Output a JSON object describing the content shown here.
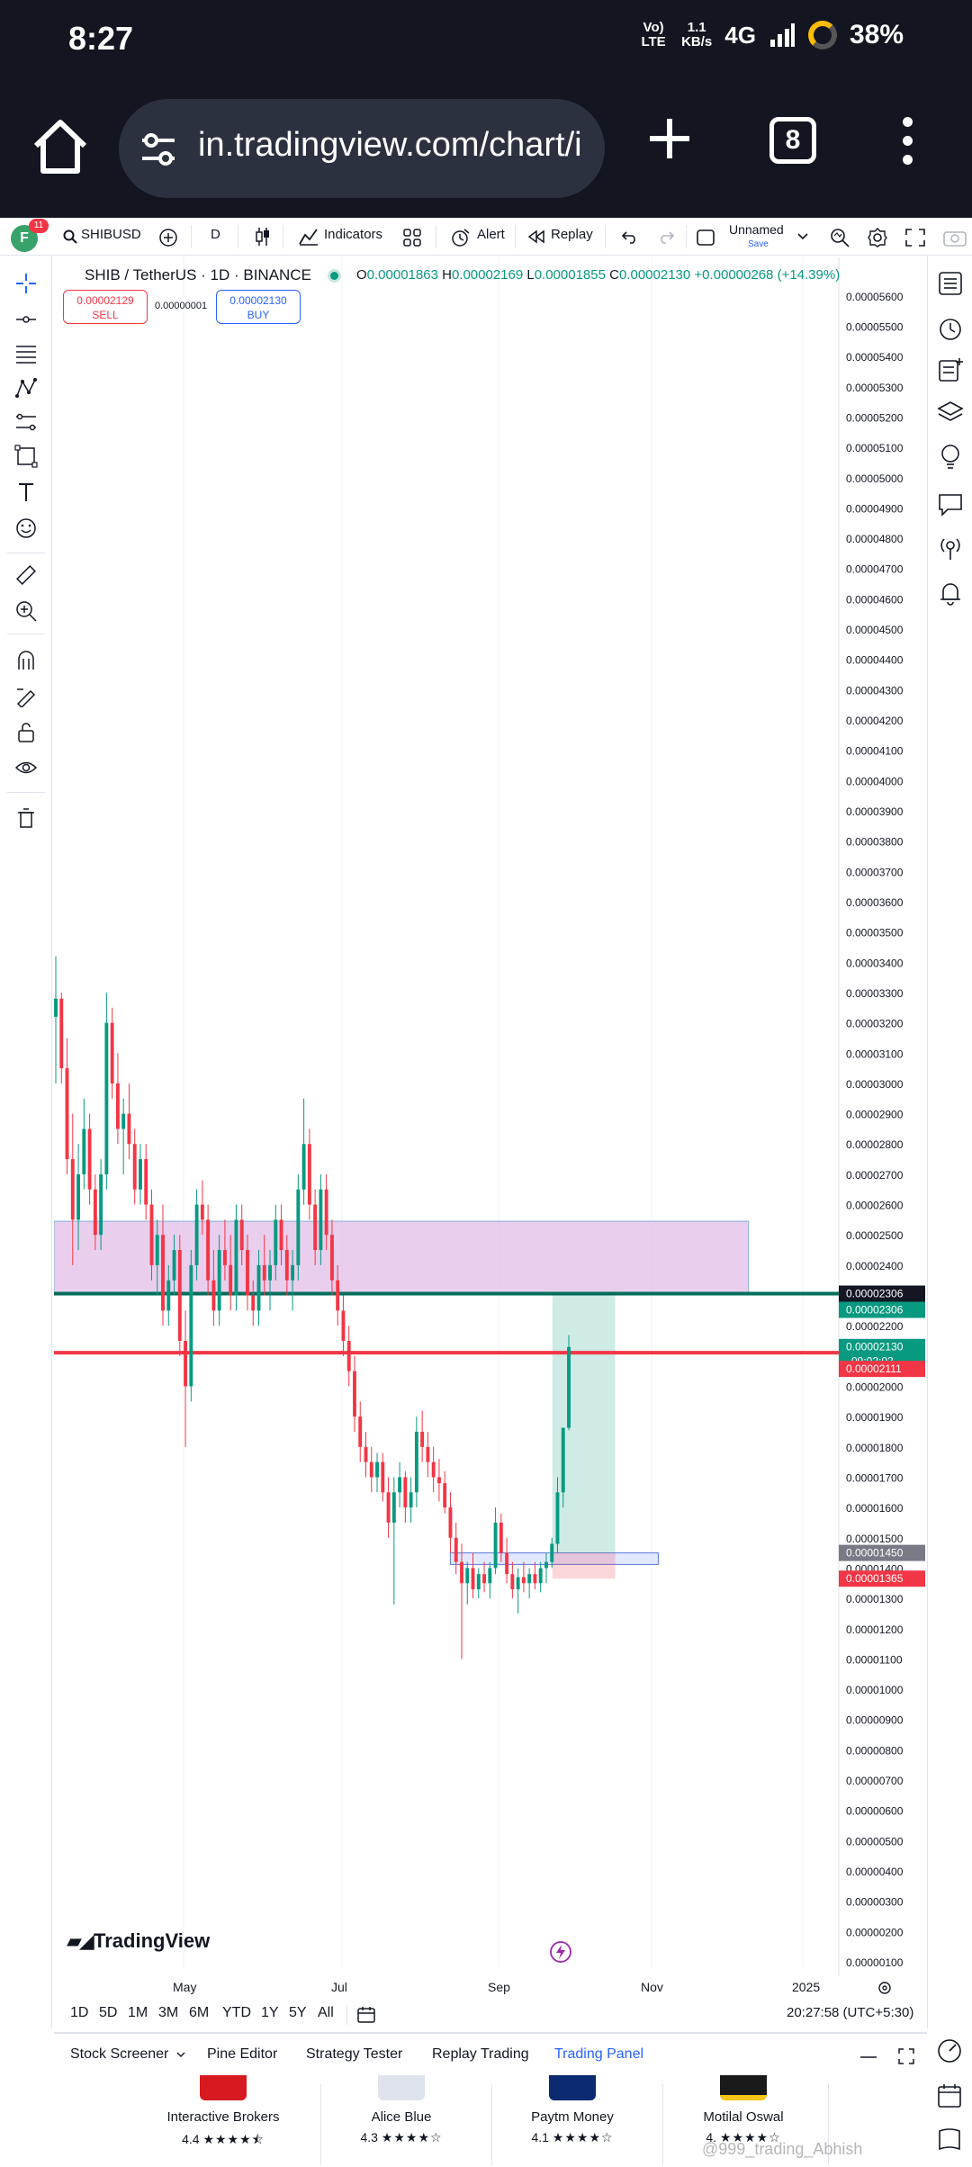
{
  "status": {
    "time": "8:27",
    "volte": "Vo) LTE",
    "speed_value": "1.1",
    "speed_unit": "KB/s",
    "network": "4G",
    "battery": "38%"
  },
  "browser": {
    "url": "in.tradingview.com/chart/i",
    "tab_count": "8"
  },
  "toolbar": {
    "avatar_letter": "F",
    "notifications": "11",
    "symbol": "SHIBUSD",
    "interval": "D",
    "indicators_label": "Indicators",
    "alert_label": "Alert",
    "replay_label": "Replay",
    "layout_name": "Unnamed",
    "save_label": "Save"
  },
  "legend": {
    "title": "SHIB / TetherUS · 1D · BINANCE",
    "open_label": "O",
    "open": "0.00001863",
    "high_label": "H",
    "high": "0.00002169",
    "low_label": "L",
    "low": "0.00001855",
    "close_label": "C",
    "close": "0.00002130",
    "change": "+0.00000268 (+14.39%)",
    "sell_price": "0.00002129",
    "sell_label": "SELL",
    "spread": "0.00000001",
    "buy_price": "0.00002130",
    "buy_label": "BUY"
  },
  "chart_data": {
    "type": "candlestick",
    "symbol": "SHIB / TetherUS",
    "interval": "1D",
    "exchange": "BINANCE",
    "y_ticks": [
      "0.00005600",
      "0.00005500",
      "0.00005400",
      "0.00005300",
      "0.00005200",
      "0.00005100",
      "0.00005000",
      "0.00004900",
      "0.00004800",
      "0.00004700",
      "0.00004600",
      "0.00004500",
      "0.00004400",
      "0.00004300",
      "0.00004200",
      "0.00004100",
      "0.00004000",
      "0.00003900",
      "0.00003800",
      "0.00003700",
      "0.00003600",
      "0.00003500",
      "0.00003400",
      "0.00003300",
      "0.00003200",
      "0.00003100",
      "0.00003000",
      "0.00002900",
      "0.00002800",
      "0.00002700",
      "0.00002600",
      "0.00002500",
      "0.00002400",
      "0.00002300",
      "0.00002200",
      "0.00002100",
      "0.00002000",
      "0.00001900",
      "0.00001800",
      "0.00001700",
      "0.00001600",
      "0.00001500",
      "0.00001400",
      "0.00001300",
      "0.00001200",
      "0.00001100",
      "0.00001000",
      "0.00000900",
      "0.00000800",
      "0.00000700",
      "0.00000600",
      "0.00000500",
      "0.00000400",
      "0.00000300",
      "0.00000200",
      "0.00000100"
    ],
    "x_ticks": [
      "May",
      "Jul",
      "Sep",
      "Nov",
      "2025"
    ],
    "ylim": [
      1e-06,
      5.65e-05
    ],
    "price_labels": [
      {
        "value": 2.306e-05,
        "text": "0.00002306",
        "color": "#131722"
      },
      {
        "value": 2.306e-05,
        "text": "0.00002306",
        "color": "#089981"
      },
      {
        "value": 2.13e-05,
        "text": "0.00002130",
        "sub": "09:02:02",
        "color": "#089981"
      },
      {
        "value": 2.111e-05,
        "text": "0.00002111",
        "color": "#f23645"
      },
      {
        "value": 1.45e-05,
        "text": "0.00001450",
        "color": "#787b86"
      },
      {
        "value": 1.365e-05,
        "text": "0.00001365",
        "color": "#f23645"
      }
    ],
    "horizontal_lines": [
      {
        "value": 2.306e-05,
        "color": "#006d5b"
      },
      {
        "value": 2.111e-05,
        "color": "#f23645"
      }
    ],
    "zones": [
      {
        "from": 2.306e-05,
        "to": 2.545e-05,
        "color": "#e1bee7",
        "t_from": 0.0,
        "t_to": 0.885
      },
      {
        "from": 1.412e-05,
        "to": 1.45e-05,
        "color": "#cfd8ff",
        "t_from": 0.505,
        "t_to": 0.77
      }
    ],
    "position": {
      "entry": 1.45e-05,
      "target": 2.306e-05,
      "stop": 1.365e-05,
      "t_from": 0.635,
      "t_to": 0.715
    },
    "candles": [
      [
        3.22e-05,
        3.42e-05,
        3e-05,
        3.28e-05
      ],
      [
        3.28e-05,
        3.3e-05,
        3e-05,
        3.05e-05
      ],
      [
        3.05e-05,
        3.15e-05,
        2.7e-05,
        2.75e-05
      ],
      [
        2.75e-05,
        2.9e-05,
        2.4e-05,
        2.55e-05
      ],
      [
        2.55e-05,
        2.8e-05,
        2.45e-05,
        2.7e-05
      ],
      [
        2.7e-05,
        2.95e-05,
        2.65e-05,
        2.85e-05
      ],
      [
        2.85e-05,
        2.9e-05,
        2.6e-05,
        2.65e-05
      ],
      [
        2.65e-05,
        2.7e-05,
        2.45e-05,
        2.5e-05
      ],
      [
        2.5e-05,
        2.75e-05,
        2.45e-05,
        2.7e-05
      ],
      [
        2.7e-05,
        3.3e-05,
        2.65e-05,
        3.2e-05
      ],
      [
        3.2e-05,
        3.25e-05,
        2.95e-05,
        3e-05
      ],
      [
        3e-05,
        3.1e-05,
        2.8e-05,
        2.85e-05
      ],
      [
        2.85e-05,
        2.95e-05,
        2.7e-05,
        2.9e-05
      ],
      [
        2.9e-05,
        3e-05,
        2.75e-05,
        2.8e-05
      ],
      [
        2.8e-05,
        2.85e-05,
        2.6e-05,
        2.65e-05
      ],
      [
        2.65e-05,
        2.8e-05,
        2.6e-05,
        2.75e-05
      ],
      [
        2.75e-05,
        2.8e-05,
        2.55e-05,
        2.6e-05
      ],
      [
        2.6e-05,
        2.65e-05,
        2.35e-05,
        2.4e-05
      ],
      [
        2.4e-05,
        2.55e-05,
        2.3e-05,
        2.5e-05
      ],
      [
        2.5e-05,
        2.6e-05,
        2.2e-05,
        2.25e-05
      ],
      [
        2.25e-05,
        2.4e-05,
        2.2e-05,
        2.35e-05
      ],
      [
        2.35e-05,
        2.5e-05,
        2.3e-05,
        2.45e-05
      ],
      [
        2.45e-05,
        2.5e-05,
        2.1e-05,
        2.15e-05
      ],
      [
        2.15e-05,
        2.25e-05,
        1.8e-05,
        2e-05
      ],
      [
        2e-05,
        2.45e-05,
        1.95e-05,
        2.4e-05
      ],
      [
        2.4e-05,
        2.65e-05,
        2.35e-05,
        2.6e-05
      ],
      [
        2.6e-05,
        2.68e-05,
        2.5e-05,
        2.55e-05
      ],
      [
        2.55e-05,
        2.6e-05,
        2.3e-05,
        2.35e-05
      ],
      [
        2.35e-05,
        2.45e-05,
        2.2e-05,
        2.25e-05
      ],
      [
        2.25e-05,
        2.5e-05,
        2.2e-05,
        2.45e-05
      ],
      [
        2.45e-05,
        2.55e-05,
        2.35e-05,
        2.4e-05
      ],
      [
        2.4e-05,
        2.5e-05,
        2.25e-05,
        2.3e-05
      ],
      [
        2.3e-05,
        2.6e-05,
        2.25e-05,
        2.55e-05
      ],
      [
        2.55e-05,
        2.6e-05,
        2.4e-05,
        2.45e-05
      ],
      [
        2.45e-05,
        2.5e-05,
        2.25e-05,
        2.3e-05
      ],
      [
        2.3e-05,
        2.35e-05,
        2.2e-05,
        2.25e-05
      ],
      [
        2.25e-05,
        2.45e-05,
        2.2e-05,
        2.4e-05
      ],
      [
        2.4e-05,
        2.5e-05,
        2.3e-05,
        2.35e-05
      ],
      [
        2.35e-05,
        2.45e-05,
        2.25e-05,
        2.4e-05
      ],
      [
        2.4e-05,
        2.6e-05,
        2.35e-05,
        2.55e-05
      ],
      [
        2.55e-05,
        2.6e-05,
        2.4e-05,
        2.45e-05
      ],
      [
        2.45e-05,
        2.5e-05,
        2.3e-05,
        2.35e-05
      ],
      [
        2.35e-05,
        2.45e-05,
        2.25e-05,
        2.4e-05
      ],
      [
        2.4e-05,
        2.7e-05,
        2.35e-05,
        2.65e-05
      ],
      [
        2.65e-05,
        2.95e-05,
        2.6e-05,
        2.8e-05
      ],
      [
        2.8e-05,
        2.85e-05,
        2.55e-05,
        2.6e-05
      ],
      [
        2.6e-05,
        2.65e-05,
        2.4e-05,
        2.45e-05
      ],
      [
        2.45e-05,
        2.7e-05,
        2.4e-05,
        2.65e-05
      ],
      [
        2.65e-05,
        2.7e-05,
        2.45e-05,
        2.5e-05
      ],
      [
        2.5e-05,
        2.55e-05,
        2.3e-05,
        2.35e-05
      ],
      [
        2.35e-05,
        2.4e-05,
        2.2e-05,
        2.25e-05
      ],
      [
        2.25e-05,
        2.3e-05,
        2.1e-05,
        2.15e-05
      ],
      [
        2.15e-05,
        2.2e-05,
        2e-05,
        2.05e-05
      ],
      [
        2.05e-05,
        2.1e-05,
        1.85e-05,
        1.9e-05
      ],
      [
        1.9e-05,
        1.95e-05,
        1.75e-05,
        1.8e-05
      ],
      [
        1.8e-05,
        1.85e-05,
        1.7e-05,
        1.75e-05
      ],
      [
        1.75e-05,
        1.8e-05,
        1.65e-05,
        1.7e-05
      ],
      [
        1.7e-05,
        1.78e-05,
        1.65e-05,
        1.75e-05
      ],
      [
        1.75e-05,
        1.78e-05,
        1.62e-05,
        1.65e-05
      ],
      [
        1.65e-05,
        1.7e-05,
        1.5e-05,
        1.55e-05
      ],
      [
        1.55e-05,
        1.7e-05,
        1.28e-05,
        1.65e-05
      ],
      [
        1.65e-05,
        1.75e-05,
        1.6e-05,
        1.7e-05
      ],
      [
        1.7e-05,
        1.72e-05,
        1.55e-05,
        1.6e-05
      ],
      [
        1.6e-05,
        1.7e-05,
        1.55e-05,
        1.65e-05
      ],
      [
        1.65e-05,
        1.9e-05,
        1.6e-05,
        1.85e-05
      ],
      [
        1.85e-05,
        1.92e-05,
        1.75e-05,
        1.8e-05
      ],
      [
        1.8e-05,
        1.85e-05,
        1.7e-05,
        1.75e-05
      ],
      [
        1.75e-05,
        1.8e-05,
        1.65e-05,
        1.7e-05
      ],
      [
        1.7e-05,
        1.76e-05,
        1.62e-05,
        1.68e-05
      ],
      [
        1.68e-05,
        1.72e-05,
        1.58e-05,
        1.6e-05
      ],
      [
        1.6e-05,
        1.65e-05,
        1.45e-05,
        1.5e-05
      ],
      [
        1.5e-05,
        1.55e-05,
        1.38e-05,
        1.42e-05
      ],
      [
        1.42e-05,
        1.48e-05,
        1.1e-05,
        1.35e-05
      ],
      [
        1.35e-05,
        1.42e-05,
        1.28e-05,
        1.4e-05
      ],
      [
        1.4e-05,
        1.45e-05,
        1.3e-05,
        1.33e-05
      ],
      [
        1.33e-05,
        1.4e-05,
        1.3e-05,
        1.38e-05
      ],
      [
        1.38e-05,
        1.42e-05,
        1.32e-05,
        1.35e-05
      ],
      [
        1.35e-05,
        1.42e-05,
        1.3e-05,
        1.4e-05
      ],
      [
        1.4e-05,
        1.6e-05,
        1.38e-05,
        1.55e-05
      ],
      [
        1.55e-05,
        1.58e-05,
        1.42e-05,
        1.45e-05
      ],
      [
        1.45e-05,
        1.5e-05,
        1.35e-05,
        1.38e-05
      ],
      [
        1.38e-05,
        1.42e-05,
        1.3e-05,
        1.33e-05
      ],
      [
        1.33e-05,
        1.4e-05,
        1.25e-05,
        1.37e-05
      ],
      [
        1.37e-05,
        1.42e-05,
        1.32e-05,
        1.35e-05
      ],
      [
        1.35e-05,
        1.4e-05,
        1.3e-05,
        1.38e-05
      ],
      [
        1.38e-05,
        1.42e-05,
        1.33e-05,
        1.35e-05
      ],
      [
        1.35e-05,
        1.42e-05,
        1.32e-05,
        1.4e-05
      ],
      [
        1.4e-05,
        1.45e-05,
        1.35e-05,
        1.42e-05
      ],
      [
        1.42e-05,
        1.5e-05,
        1.4e-05,
        1.48e-05
      ],
      [
        1.48e-05,
        1.7e-05,
        1.45e-05,
        1.65e-05
      ],
      [
        1.65e-05,
        1.863e-05,
        1.6e-05,
        1.863e-05
      ],
      [
        1.863e-05,
        2.169e-05,
        1.855e-05,
        2.13e-05
      ]
    ]
  },
  "x_axis": {
    "ticks": [
      "May",
      "Jul",
      "Sep",
      "Nov",
      "2025"
    ]
  },
  "branding": {
    "logo_text": "TradingView"
  },
  "ranges": [
    "1D",
    "5D",
    "1M",
    "3M",
    "6M",
    "YTD",
    "1Y",
    "5Y",
    "All"
  ],
  "clock": "20:27:58 (UTC+5:30)",
  "bottom_tabs": [
    "Stock Screener",
    "Pine Editor",
    "Strategy Tester",
    "Replay Trading",
    "Trading Panel"
  ],
  "brokers": [
    {
      "name": "Interactive Brokers",
      "rating": "4.4",
      "color": "#d71920"
    },
    {
      "name": "Alice Blue",
      "rating": "4.3",
      "color": "#dfe3ee"
    },
    {
      "name": "Paytm Money",
      "rating": "4.1",
      "color": "#0b2a6f"
    },
    {
      "name": "Motilal Oswal",
      "rating": "4.",
      "color": "#1a1a1a"
    }
  ],
  "watermark": "@999_trading_Abhish"
}
